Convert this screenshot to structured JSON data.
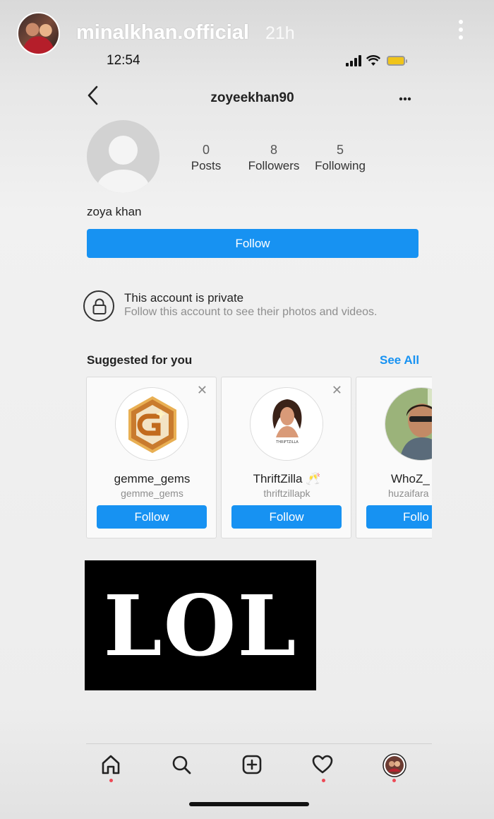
{
  "story": {
    "username": "minalkhan.official",
    "time": "21h"
  },
  "status_bar": {
    "time": "12:54"
  },
  "profile": {
    "handle": "zoyeekhan90",
    "full_name": "zoya khan",
    "stats": [
      {
        "value": "0",
        "label": "Posts"
      },
      {
        "value": "8",
        "label": "Followers"
      },
      {
        "value": "5",
        "label": "Following"
      }
    ],
    "follow_label": "Follow"
  },
  "private_notice": {
    "title": "This account is private",
    "subtitle": "Follow this account to see their photos and videos."
  },
  "suggested": {
    "heading": "Suggested for you",
    "see_all": "See All",
    "cards": [
      {
        "name": "gemme_gems",
        "username": "gemme_gems",
        "button": "Follow"
      },
      {
        "name": "ThriftZilla",
        "username": "thriftzillapk",
        "button": "Follow",
        "logo_text": "THRIFTZILLA"
      },
      {
        "name": "WhoZ_",
        "username": "huzaifara",
        "button": "Follo"
      }
    ]
  },
  "sticker": {
    "text": "LOL"
  },
  "colors": {
    "accent": "#1792f2",
    "notification": "#ed4956"
  }
}
